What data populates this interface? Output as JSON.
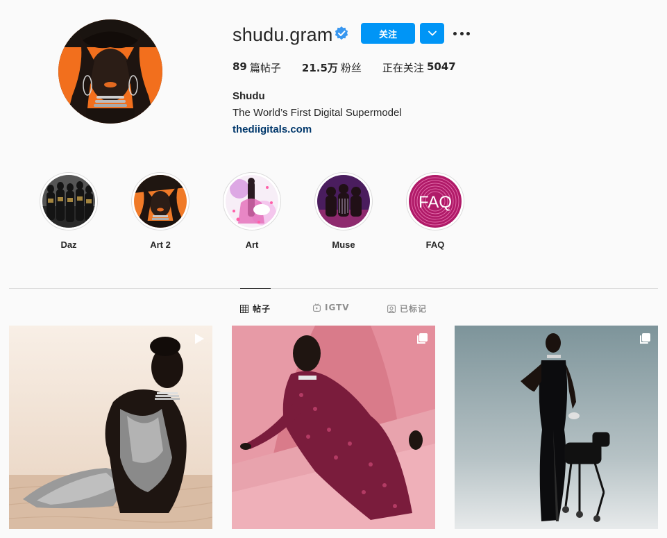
{
  "profile": {
    "username": "shudu.gram",
    "verified": true,
    "follow_label": "关注",
    "stats": {
      "posts_count": "89",
      "posts_label": "篇帖子",
      "followers_count": "21.5万",
      "followers_label": "粉丝",
      "following_label": "正在关注",
      "following_count": "5047"
    },
    "full_name": "Shudu",
    "bio": "The World’s First Digital Supermodel",
    "website": "thediigitals.com"
  },
  "highlights": [
    {
      "label": "Daz"
    },
    {
      "label": "Art 2"
    },
    {
      "label": "Art"
    },
    {
      "label": "Muse"
    },
    {
      "label": "FAQ",
      "image_text": "FAQ"
    }
  ],
  "tabs": [
    {
      "label": "帖子",
      "icon": "grid-icon",
      "active": true
    },
    {
      "label": "IGTV",
      "icon": "igtv-icon",
      "active": false
    },
    {
      "label": "已标记",
      "icon": "tagged-icon",
      "active": false
    }
  ],
  "posts": [
    {
      "type": "video",
      "icon": "play-icon"
    },
    {
      "type": "carousel",
      "icon": "carousel-icon"
    },
    {
      "type": "carousel",
      "icon": "carousel-icon"
    }
  ],
  "colors": {
    "accent": "#0095f6",
    "link": "#00376b",
    "text": "#262626",
    "muted": "#8e8e8e",
    "border": "#dbdbdb",
    "background": "#fafafa"
  }
}
